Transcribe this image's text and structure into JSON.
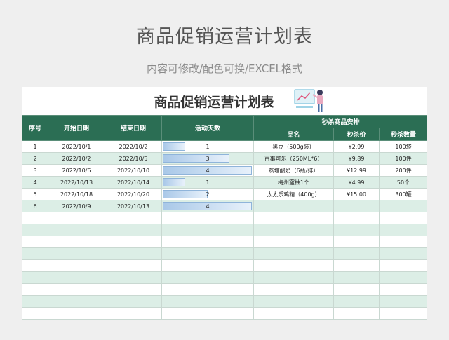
{
  "page": {
    "title": "商品促销运营计划表",
    "subtitle": "内容可修改/配色可换/EXCEL格式"
  },
  "sheet": {
    "title": "商品促销运营计划表",
    "headers": {
      "seq": "序号",
      "start": "开始日期",
      "end": "结束日期",
      "days": "活动天数",
      "group": "秒杀商品安排",
      "name": "品名",
      "price": "秒杀价",
      "qty": "秒杀数量"
    },
    "max_days": 4,
    "rows": [
      {
        "seq": "1",
        "start": "2022/10/1",
        "end": "2022/10/2",
        "days": 1,
        "name": "黑豆（500g装）",
        "price": "¥2.99",
        "qty": "100袋"
      },
      {
        "seq": "2",
        "start": "2022/10/2",
        "end": "2022/10/5",
        "days": 3,
        "name": "百事可乐（250ML*6）",
        "price": "¥9.89",
        "qty": "100件"
      },
      {
        "seq": "3",
        "start": "2022/10/6",
        "end": "2022/10/10",
        "days": 4,
        "name": "燕塘酸奶（6瓶/排）",
        "price": "¥12.99",
        "qty": "200件"
      },
      {
        "seq": "4",
        "start": "2022/10/13",
        "end": "2022/10/14",
        "days": 1,
        "name": "梅州蜜柚1个",
        "price": "¥4.99",
        "qty": "50个"
      },
      {
        "seq": "5",
        "start": "2022/10/18",
        "end": "2022/10/20",
        "days": 2,
        "name": "太太乐鸡精（400g）",
        "price": "¥15.00",
        "qty": "300罐"
      },
      {
        "seq": "6",
        "start": "2022/10/9",
        "end": "2022/10/13",
        "days": 4,
        "name": "",
        "price": "",
        "qty": ""
      }
    ],
    "empty_rows": 9
  }
}
